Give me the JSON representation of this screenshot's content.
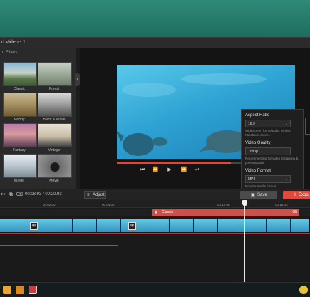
{
  "window": {
    "title": "d Video - 1"
  },
  "left_panel": {
    "header": "d Filters",
    "filters": [
      {
        "label": "Classic",
        "icon": "mountain-landscape-thumbnail"
      },
      {
        "label": "Forest",
        "icon": "foggy-forest-thumbnail"
      },
      {
        "label": "Moody",
        "icon": "field-landscape-thumbnail"
      },
      {
        "label": "Black & White",
        "icon": "bw-tree-thumbnail"
      },
      {
        "label": "Fantasy",
        "icon": "pier-sunset-thumbnail"
      },
      {
        "label": "Vintage",
        "icon": "vintage-car-thumbnail"
      },
      {
        "label": "Winter",
        "icon": "snowy-forest-thumbnail"
      },
      {
        "label": "Movie",
        "icon": "camera-thumbnail"
      }
    ]
  },
  "preview": {
    "progress": 0.64,
    "transport": [
      "skip-back-icon",
      "rewind-icon",
      "play-icon",
      "fast-forward-icon",
      "skip-forward-icon"
    ]
  },
  "export_panel": {
    "aspect_ratio_label": "Aspect Ratio",
    "aspect_ratio_value": "16:9",
    "aspect_ratio_hint": "Widescreen for Youtube, Vimeo, Facebook cover...",
    "video_quality_label": "Video Quality",
    "video_quality_value": "1080p",
    "video_quality_hint": "Recommended for video streaming & presentations",
    "video_format_label": "Video Format",
    "video_format_value": "MP4",
    "video_format_hint": "Popular media format"
  },
  "toolbar": {
    "timecode": "00:08.93 / 00:20.93",
    "adjust_label": "Adjust",
    "save_label": "Save",
    "export_label": "Expo"
  },
  "timeline": {
    "ticks": [
      "00:02.00",
      "00:04.00",
      "00:12.00",
      "00:15.00"
    ],
    "filter_clip_label": "Classic"
  },
  "colors": {
    "accent": "#e04a3c",
    "desktop": "#2f8a78"
  }
}
